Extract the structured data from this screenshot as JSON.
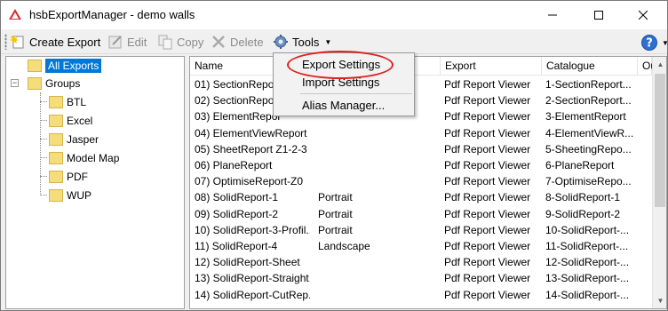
{
  "window": {
    "title": "hsbExportManager - demo walls"
  },
  "toolbar": {
    "create_export": "Create Export",
    "edit": "Edit",
    "copy": "Copy",
    "delete": "Delete",
    "tools": "Tools"
  },
  "tree": {
    "all_exports": "All Exports",
    "groups": "Groups",
    "children": [
      "BTL",
      "Excel",
      "Jasper",
      "Model Map",
      "PDF",
      "WUP"
    ]
  },
  "list": {
    "columns": [
      "Name",
      "",
      "Export",
      "Catalogue",
      "Ou"
    ],
    "rows": [
      {
        "name": "01) SectionRepor",
        "orient": "",
        "export": "Pdf Report Viewer",
        "catalogue": "1-SectionReport..."
      },
      {
        "name": "02) SectionRepor",
        "orient": "",
        "export": "Pdf Report Viewer",
        "catalogue": "2-SectionReport..."
      },
      {
        "name": "03) ElementRepor",
        "orient": "",
        "export": "Pdf Report Viewer",
        "catalogue": "3-ElementReport"
      },
      {
        "name": "04) ElementViewReport",
        "orient": "",
        "export": "Pdf Report Viewer",
        "catalogue": "4-ElementViewR..."
      },
      {
        "name": "05) SheetReport Z1-2-3",
        "orient": "",
        "export": "Pdf Report Viewer",
        "catalogue": "5-SheetingRepo..."
      },
      {
        "name": "06) PlaneReport",
        "orient": "",
        "export": "Pdf Report Viewer",
        "catalogue": "6-PlaneReport"
      },
      {
        "name": "07) OptimiseReport-Z0",
        "orient": "",
        "export": "Pdf Report Viewer",
        "catalogue": "7-OptimiseRepo..."
      },
      {
        "name": "08) SolidReport-1",
        "orient": "Portrait",
        "export": "Pdf Report Viewer",
        "catalogue": "8-SolidReport-1"
      },
      {
        "name": "09) SolidReport-2",
        "orient": "Portrait",
        "export": "Pdf Report Viewer",
        "catalogue": "9-SolidReport-2"
      },
      {
        "name": "10) SolidReport-3-Profil...",
        "orient": "Portrait",
        "export": "Pdf Report Viewer",
        "catalogue": "10-SolidReport-..."
      },
      {
        "name": "11) SolidReport-4",
        "orient": "Landscape",
        "export": "Pdf Report Viewer",
        "catalogue": "11-SolidReport-..."
      },
      {
        "name": "12) SolidReport-Sheet",
        "orient": "",
        "export": "Pdf Report Viewer",
        "catalogue": "12-SolidReport-..."
      },
      {
        "name": "13) SolidReport-Straight...",
        "orient": "",
        "export": "Pdf Report Viewer",
        "catalogue": "13-SolidReport-..."
      },
      {
        "name": "14) SolidReport-CutRep...",
        "orient": "",
        "export": "Pdf Report Viewer",
        "catalogue": "14-SolidReport-..."
      }
    ]
  },
  "tools_menu": {
    "items": [
      "Export Settings",
      "Import Settings",
      "Alias Manager..."
    ]
  },
  "colors": {
    "selection": "#0078d7",
    "highlight_circle": "#dd2222"
  }
}
